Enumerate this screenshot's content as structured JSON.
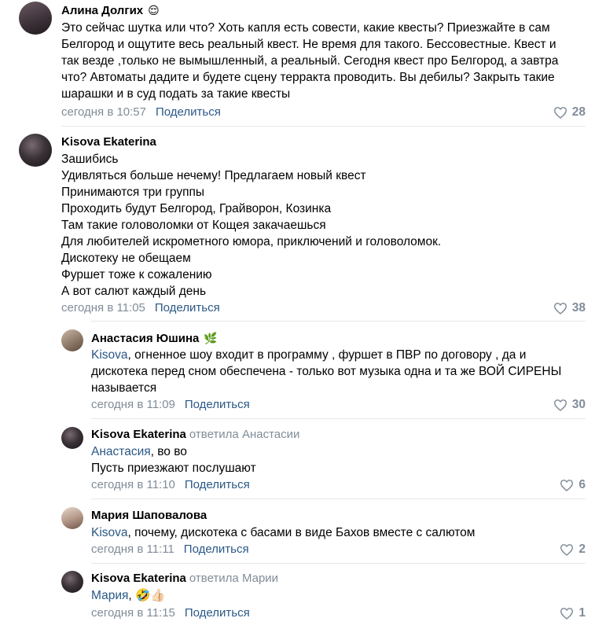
{
  "comments": [
    {
      "author": "Алина Долгих",
      "author_emoji": "😌",
      "lines": [
        "Это сейчас шутка или что? Хоть капля есть совести, какие квесты? Приезжайте в сам",
        "Белгород и ощутите весь реальный квест. Не время для такого. Бессовестные. Квест и",
        "так везде ,только не вымышленный, а реальный. Сегодня квест про Белгород, а завтра",
        "что? Автоматы дадите и будете сцену терракта проводить. Вы дебилы? Закрыть такие",
        "шарашки и в суд подать за такие квесты"
      ],
      "time": "сегодня в 10:57",
      "share": "Поделиться",
      "likes": "28"
    },
    {
      "author": "Kisova Ekaterina",
      "lines": [
        "Зашибись",
        "Удивляться больше нечему! Предлагаем новый квест",
        "Принимаются три группы",
        "Проходить будут Белгород, Грайворон, Козинка",
        "Там такие головоломки от Кощея закачаешься",
        "Для любителей искрометного юмора, приключений и головоломок.",
        "Дискотеку не обещаем",
        "Фуршет тоже к сожалению",
        "А вот салют каждый день"
      ],
      "time": "сегодня в 11:05",
      "share": "Поделиться",
      "likes": "38"
    }
  ],
  "replies": [
    {
      "author": "Анастасия Юшина",
      "author_emoji": "🌿",
      "mention": "Kisova",
      "first_line_rest": ", огненное шоу входит в программу , фуршет в ПВР по договору , да и",
      "lines": [
        "дискотека перед сном обеспечена - только вот музыка одна и та же ВОЙ СИРЕНЫ",
        "называется"
      ],
      "time": "сегодня в 11:09",
      "share": "Поделиться",
      "likes": "30"
    },
    {
      "author": "Kisova Ekaterina",
      "replied_to": "ответила Анастасии",
      "mention": "Анастасия",
      "first_line_rest": ", во во",
      "lines": [
        "Пусть приезжают послушают"
      ],
      "time": "сегодня в 11:10",
      "share": "Поделиться",
      "likes": "6"
    },
    {
      "author": "Мария Шаповалова",
      "mention": "Kisova",
      "first_line_rest": ", почему, дискотека с басами в виде Бахов вместе с салютом",
      "lines": [],
      "time": "сегодня в 11:11",
      "share": "Поделиться",
      "likes": "2"
    },
    {
      "author": "Kisova Ekaterina",
      "replied_to": "ответила Марии",
      "mention": "Мария",
      "first_line_rest": ", 🤣👍🏻",
      "lines": [],
      "time": "сегодня в 11:15",
      "share": "Поделиться",
      "likes": "1"
    }
  ]
}
